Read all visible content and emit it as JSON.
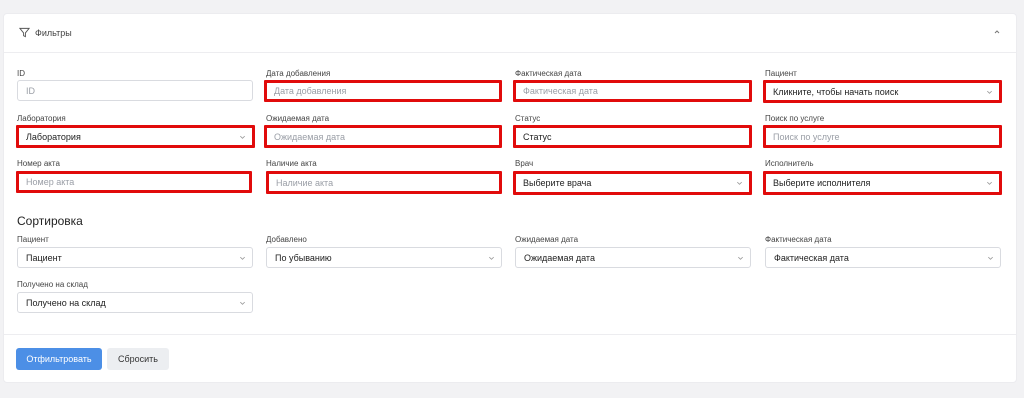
{
  "header": {
    "title": "Фильтры"
  },
  "filters": {
    "id": {
      "label": "ID",
      "placeholder": "ID"
    },
    "date_added": {
      "label": "Дата добавления",
      "placeholder": "Дата добавления"
    },
    "actual_date": {
      "label": "Фактическая дата",
      "placeholder": "Фактическая дата"
    },
    "patient": {
      "label": "Пациент",
      "value": "Кликните, чтобы начать поиск"
    },
    "laboratory": {
      "label": "Лаборатория",
      "value": "Лаборатория"
    },
    "expected_date": {
      "label": "Ожидаемая дата",
      "placeholder": "Ожидаемая дата"
    },
    "status": {
      "label": "Статус",
      "value": "Статус"
    },
    "service_search": {
      "label": "Поиск по услуге",
      "placeholder": "Поиск по услуге"
    },
    "act_number": {
      "label": "Номер акта",
      "placeholder": "Номер акта"
    },
    "act_presence": {
      "label": "Наличие акта",
      "placeholder": "Наличие акта"
    },
    "doctor": {
      "label": "Врач",
      "value": "Выберите врача"
    },
    "executor": {
      "label": "Исполнитель",
      "value": "Выберите исполнителя"
    }
  },
  "sorting": {
    "title": "Сортировка",
    "patient": {
      "label": "Пациент",
      "value": "Пациент"
    },
    "added": {
      "label": "Добавлено",
      "value": "По убыванию"
    },
    "expected_date": {
      "label": "Ожидаемая дата",
      "value": "Ожидаемая дата"
    },
    "actual_date": {
      "label": "Фактическая дата",
      "value": "Фактическая дата"
    },
    "received": {
      "label": "Получено на склад",
      "value": "Получено на склад"
    }
  },
  "buttons": {
    "apply": "Отфильтровать",
    "reset": "Сбросить"
  },
  "colors": {
    "highlight": "#e10b0b",
    "primary": "#4c8fe6"
  }
}
